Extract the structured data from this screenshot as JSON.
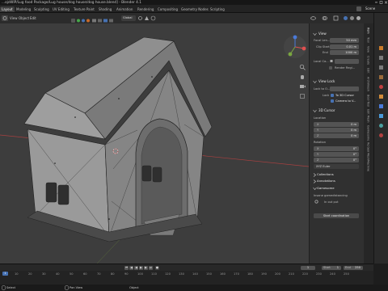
{
  "window": {
    "title": "...ojsWIP/Lug food Package/Lug house/dog house/dog house.blend] - Blender 4.1"
  },
  "workspace_tabs": [
    {
      "label": "Layout",
      "active": true
    },
    {
      "label": "Modeling",
      "active": false
    },
    {
      "label": "Sculpting",
      "active": false
    },
    {
      "label": "UV Editing",
      "active": false
    },
    {
      "label": "Texture Paint",
      "active": false
    },
    {
      "label": "Shading",
      "active": false
    },
    {
      "label": "Animation",
      "active": false
    },
    {
      "label": "Rendering",
      "active": false
    },
    {
      "label": "Compositing",
      "active": false
    },
    {
      "label": "Geometry Nodes",
      "active": false
    },
    {
      "label": "Scripting",
      "active": false
    }
  ],
  "topright": {
    "scene_label": "Scene"
  },
  "header": {
    "menus": [
      "View",
      "Object",
      "Edit"
    ],
    "transform_orientation": "Global",
    "options_label": "Options"
  },
  "npanel": {
    "view_section": "View",
    "focal_length_label": "Focal Len...",
    "focal_length": "50 mm",
    "clip_start_label": "Clip Start",
    "clip_start": "0.01 m",
    "clip_end_label": "End",
    "clip_end": "1000 m",
    "local_camera_label": "Local Ca...",
    "render_region_label": "Render Regi...",
    "view_lock_section": "View Lock",
    "lock_to_object_label": "Lock to O...",
    "lock_label": "Lock",
    "lock_to_3d_cursor": "To 3D Cursor",
    "lock_camera_to_view": "Camera to V...",
    "cursor_section": "3D Cursor",
    "location_label": "Location",
    "location": [
      {
        "axis": "X",
        "value": "0 m"
      },
      {
        "axis": "Y",
        "value": "0 m"
      },
      {
        "axis": "Z",
        "value": "0 m"
      }
    ],
    "rotation_label": "Rotation",
    "rotation": [
      {
        "axis": "X",
        "value": "0°"
      },
      {
        "axis": "Y",
        "value": "0°"
      },
      {
        "axis": "Z",
        "value": "0°"
      }
    ],
    "rotation_mode": "XYZ Euler",
    "collections_section": "Collections",
    "annotations_section": "Annotations",
    "gamesome_section": "Gamesome",
    "insane_label": "Insane gamedistancing",
    "in_out_label": "In out put",
    "start_coordinate_button": "Start coordination"
  },
  "sidebar_tabs": [
    "Item",
    "Tool",
    "View",
    "Create",
    "Edit",
    "Archimesh",
    "Bool Tool",
    "Edit Mesh",
    "Gamesome",
    "Re:Gen",
    "MeshMachine"
  ],
  "timeline": {
    "ticks": [
      "0",
      "10",
      "20",
      "30",
      "40",
      "50",
      "60",
      "70",
      "80",
      "90",
      "100",
      "110",
      "120",
      "130",
      "140",
      "150",
      "160",
      "170",
      "180",
      "190",
      "200",
      "210",
      "220",
      "230",
      "240",
      "250"
    ],
    "current_frame": "1",
    "start_label": "Start",
    "start": "1",
    "end_label": "End",
    "end": "250"
  },
  "status": {
    "select": "Select",
    "pan": "Pan View",
    "context": "Object"
  },
  "colors": {
    "accent": "#4772b3",
    "viewport": "#3d3d3d",
    "panel": "#303030"
  }
}
